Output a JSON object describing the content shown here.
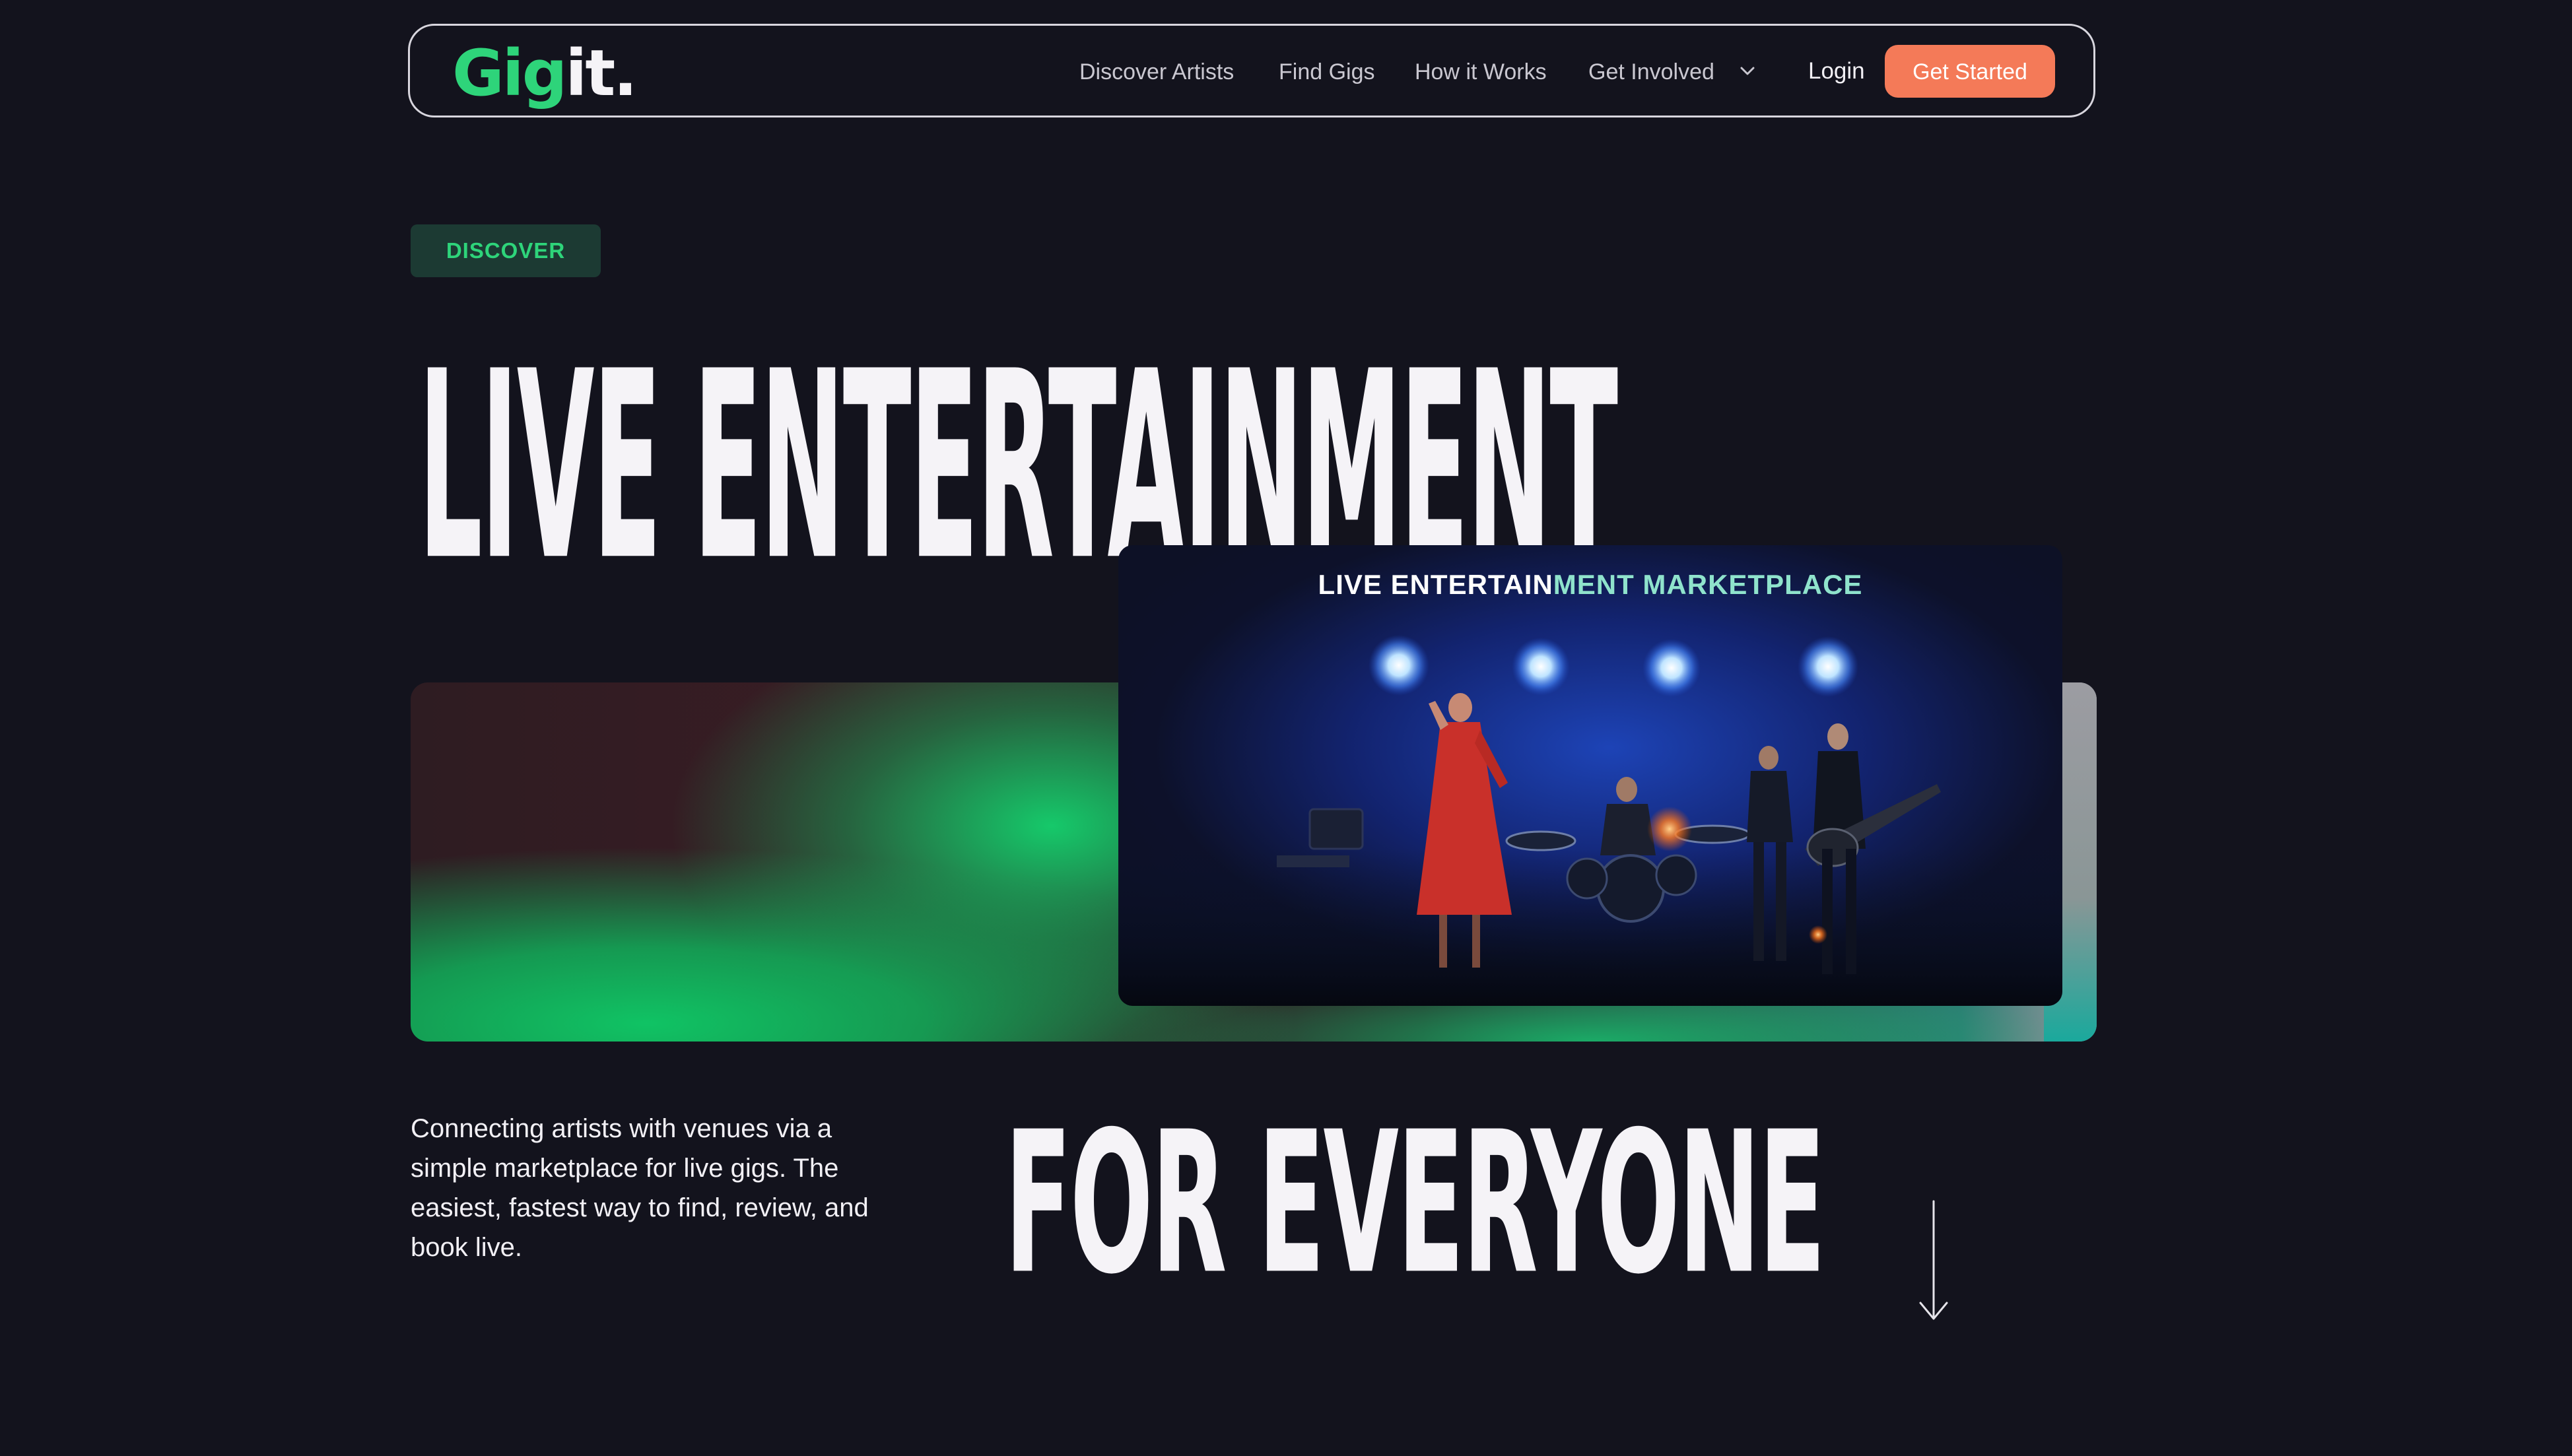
{
  "nav": {
    "logo_prefix": "Gig",
    "logo_suffix": "it.",
    "links": [
      {
        "label": "Discover Artists"
      },
      {
        "label": "Find Gigs"
      },
      {
        "label": "How it Works"
      },
      {
        "label": "Get Involved"
      }
    ],
    "login": "Login",
    "cta": "Get Started"
  },
  "hero": {
    "badge": "DISCOVER",
    "headline_top": "LIVE ENTERTAINMENT",
    "headline_bottom": "FOR EVERYONE",
    "description": "Connecting artists with venues via a simple marketplace for live gigs. The easiest, fastest way to find, review, and book live.",
    "video_title_a": "LIVE ENTERTAIN",
    "video_title_b": "MENT MARKETPLACE"
  },
  "colors": {
    "background": "#13131d",
    "accent_green": "#2ed47a",
    "cta_orange": "#f47a58",
    "badge_bg": "#1c3a33"
  }
}
